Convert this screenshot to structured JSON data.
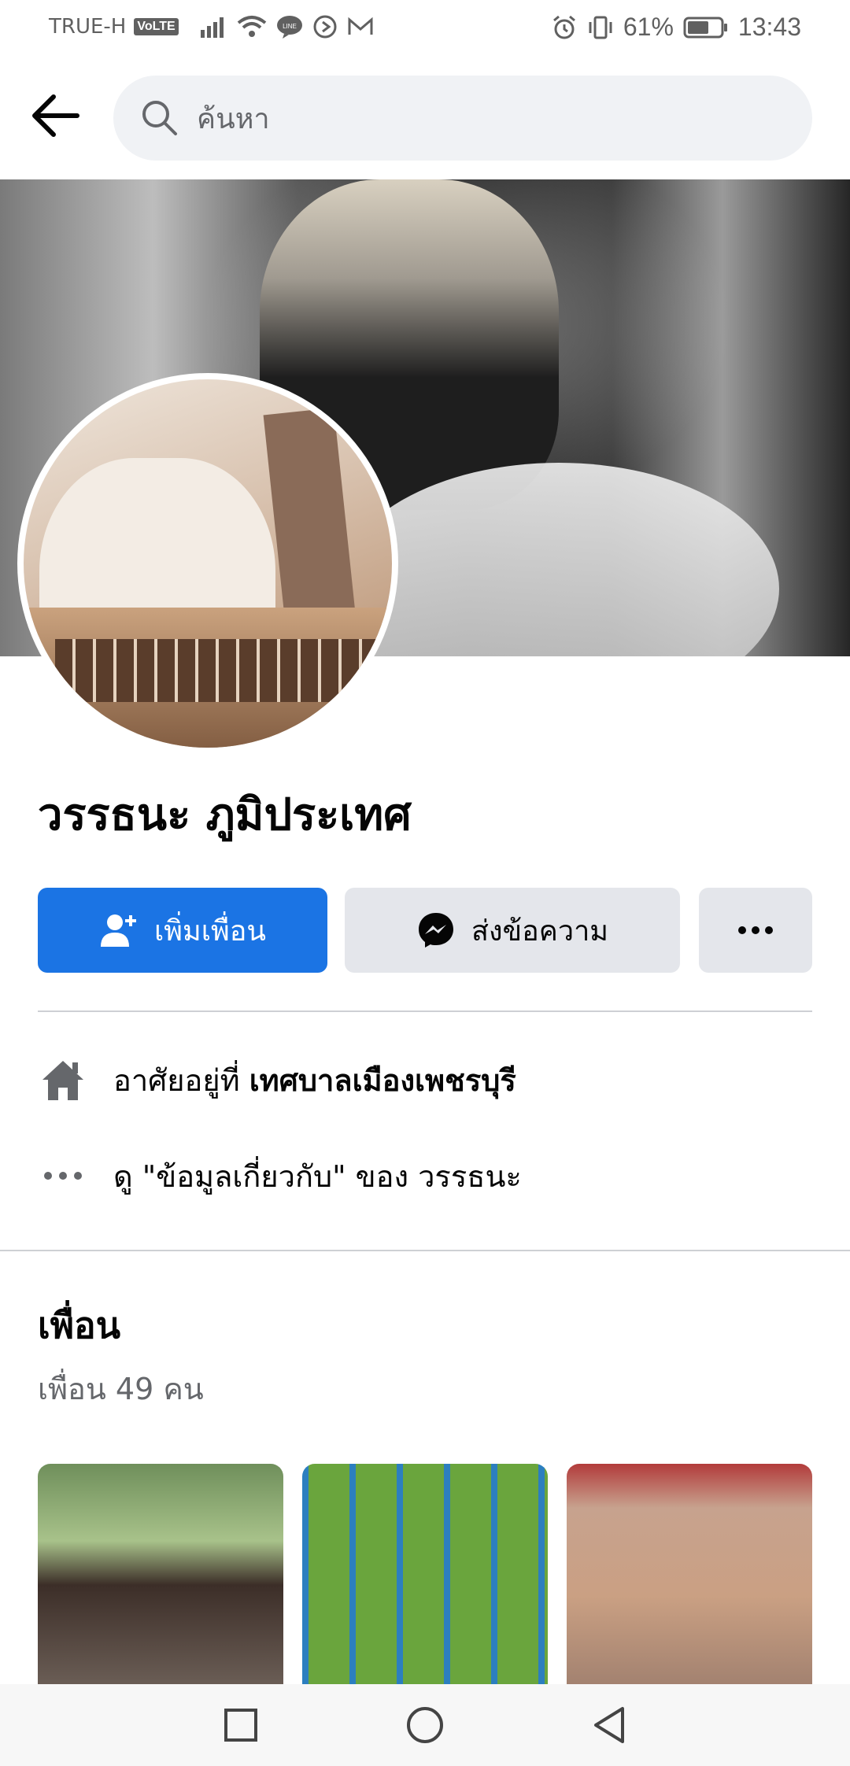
{
  "status_bar": {
    "carrier": "TRUE-H",
    "volte": "VoLTE",
    "battery": "61%",
    "time": "13:43"
  },
  "header": {
    "search_placeholder": "ค้นหา"
  },
  "profile": {
    "name": "วรรธนะ ภูมิประเทศ"
  },
  "actions": {
    "add_friend": "เพิ่มเพื่อน",
    "message": "ส่งข้อความ"
  },
  "info": {
    "lives_in_prefix": "อาศัยอยู่ที่",
    "lives_in_place": "เทศบาลเมืองเพชรบุรี",
    "about_link": "ดู \"ข้อมูลเกี่ยวกับ\" ของ วรรธนะ"
  },
  "friends": {
    "title": "เพื่อน",
    "count": "เพื่อน 49 คน"
  },
  "colors": {
    "accent": "#1b74e4",
    "button_gray": "#e4e6eb",
    "secondary_text": "#65676b"
  }
}
